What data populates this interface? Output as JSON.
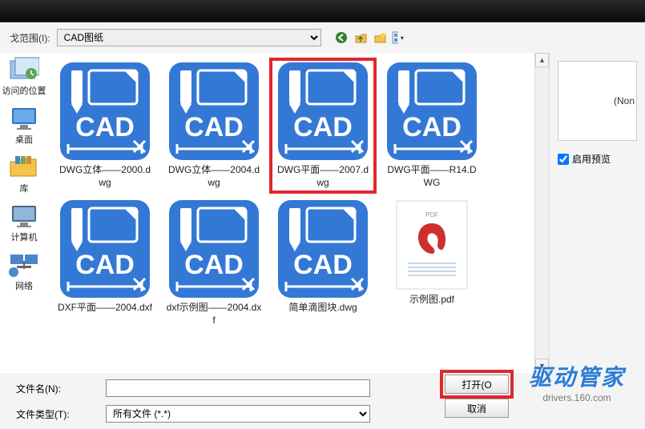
{
  "top": {
    "rangeLabel": "戈范围(I):",
    "folder": "CAD图纸"
  },
  "sidebar": {
    "items": [
      {
        "label": "访问的位置"
      },
      {
        "label": "桌面"
      },
      {
        "label": "库"
      },
      {
        "label": "计算机"
      },
      {
        "label": "网络"
      }
    ]
  },
  "files": [
    {
      "name": "DWG立体——2000.dwg",
      "type": "cad",
      "selected": false
    },
    {
      "name": "DWG立体——2004.dwg",
      "type": "cad",
      "selected": false
    },
    {
      "name": "DWG平面——2007.dwg",
      "type": "cad",
      "selected": true
    },
    {
      "name": "DWG平面——R14.DWG",
      "type": "cad",
      "selected": false
    },
    {
      "name": "DXF平面——2004.dxf",
      "type": "cad",
      "selected": false
    },
    {
      "name": "dxf示例图——2004.dxf",
      "type": "cad",
      "selected": false
    },
    {
      "name": "简单滴图块.dwg",
      "type": "cad",
      "selected": false
    },
    {
      "name": "示例图.pdf",
      "type": "pdf",
      "selected": false
    }
  ],
  "preview": {
    "placeholder": "(Non",
    "enableLabel": "启用预览"
  },
  "bottom": {
    "fileNameLabel": "文件名(N):",
    "fileNameValue": "",
    "fileTypeLabel": "文件类型(T):",
    "fileTypeValue": "所有文件 (*.*)",
    "open": "打开(O",
    "cancel": "取消"
  },
  "watermark": {
    "cn": "驱动管家",
    "en": "drivers.160.com"
  },
  "pdf": {
    "header": "PDF"
  }
}
